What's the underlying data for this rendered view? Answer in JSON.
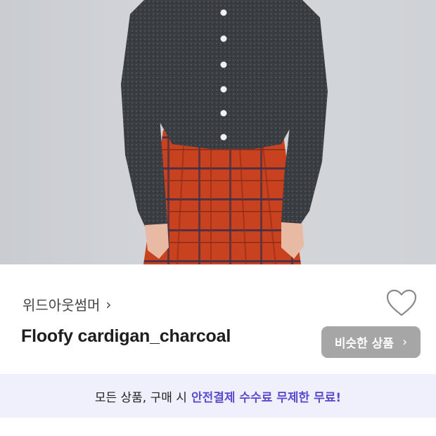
{
  "product": {
    "shop_name": "위드아웃썸머",
    "shop_chevron": "›",
    "title": "Floofy cardigan_charcoal",
    "similar_button_label": "비슷한 상품",
    "similar_button_chevron": "›",
    "heart_icon": "heart-outline-icon"
  },
  "banner": {
    "text": "모든 상품, 구매 시",
    "highlight": "안전결제 수수료 무제한 무료!"
  },
  "colors": {
    "accent": "#5b4bd1",
    "banner_bg": "#eff0fb",
    "button_bg": "#a6a6a6"
  }
}
